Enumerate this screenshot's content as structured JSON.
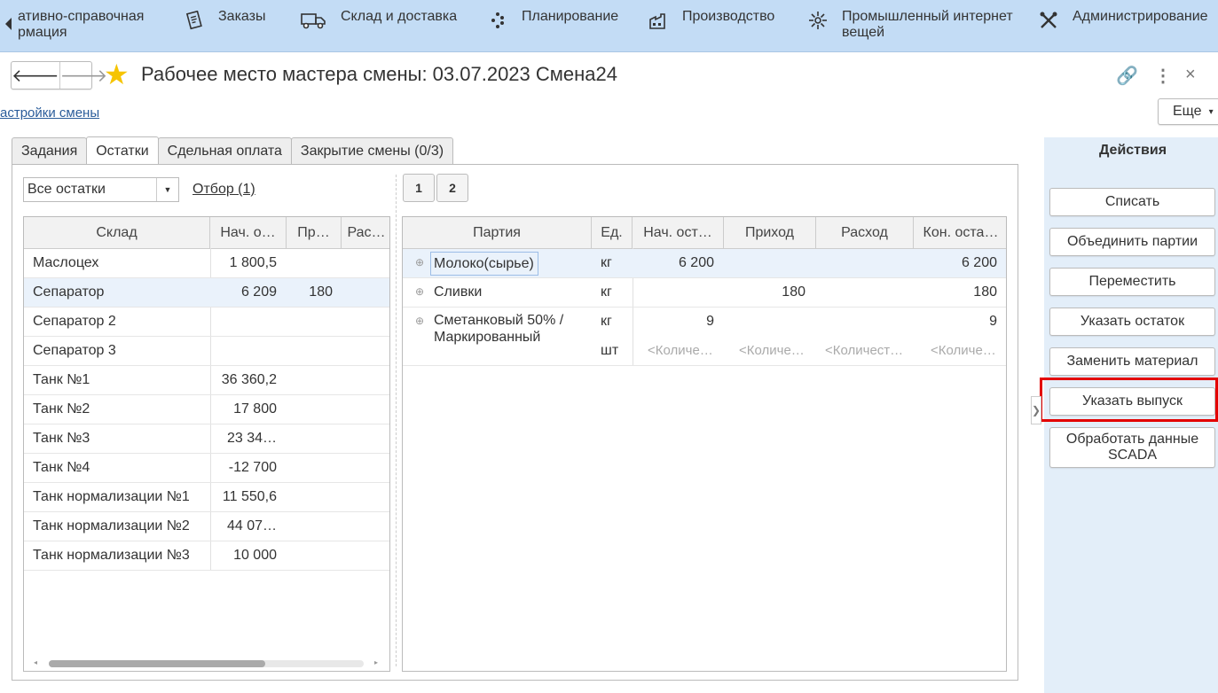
{
  "nav": {
    "items": [
      {
        "label_line1": "ативно-справочная",
        "label_line2": "рмация",
        "icon": "none"
      },
      {
        "label_line1": "Заказы",
        "label_line2": "",
        "icon": "orders-icon"
      },
      {
        "label_line1": "Склад и доставка",
        "label_line2": "",
        "icon": "truck-icon"
      },
      {
        "label_line1": "Планирование",
        "label_line2": "",
        "icon": "planning-icon"
      },
      {
        "label_line1": "Производство",
        "label_line2": "",
        "icon": "factory-icon"
      },
      {
        "label_line1": "Промышленный интернет",
        "label_line2": "вещей",
        "icon": "iot-icon"
      },
      {
        "label_line1": "Администрирование",
        "label_line2": "",
        "icon": "tools-icon"
      }
    ]
  },
  "header": {
    "back_glyph": "🡐",
    "forward_glyph": "🡒",
    "star_glyph": "★",
    "title": "Рабочее место мастера смены: 03.07.2023 Смена24",
    "link_glyph": "🔗",
    "menu_glyph": "⋮",
    "close_glyph": "×"
  },
  "shift_settings_link": "астройки смены",
  "more_button": {
    "label": "Еще",
    "arrow": "▾"
  },
  "tabs": [
    "Задания",
    "Остатки",
    "Сдельная оплата",
    "Закрытие смены (0/3)"
  ],
  "filter": {
    "select_value": "Все остатки",
    "select_arrow": "▼",
    "otbor_label": "Отбор (1)"
  },
  "pages": [
    "1",
    "2"
  ],
  "left_table": {
    "headers": [
      "Склад",
      "Нач. о…",
      "Пр…",
      "Рас…"
    ],
    "rows": [
      {
        "sklad": "Маслоцех",
        "nach": "1 800,5",
        "prih": "",
        "rash": ""
      },
      {
        "sklad": "Сепаратор",
        "nach": "6 209",
        "prih": "180",
        "rash": ""
      },
      {
        "sklad": "Сепаратор 2",
        "nach": "",
        "prih": "",
        "rash": ""
      },
      {
        "sklad": "Сепаратор 3",
        "nach": "",
        "prih": "",
        "rash": ""
      },
      {
        "sklad": "Танк №1",
        "nach": "36 360,2",
        "prih": "",
        "rash": ""
      },
      {
        "sklad": "Танк №2",
        "nach": "17 800",
        "prih": "",
        "rash": ""
      },
      {
        "sklad": "Танк №3",
        "nach": "23 34…",
        "prih": "",
        "rash": ""
      },
      {
        "sklad": "Танк №4",
        "nach": "-12 700",
        "prih": "",
        "rash": ""
      },
      {
        "sklad": "Танк нормализации №1",
        "nach": "11 550,6",
        "prih": "",
        "rash": ""
      },
      {
        "sklad": "Танк нормализации №2",
        "nach": "44 07…",
        "prih": "",
        "rash": ""
      },
      {
        "sklad": "Танк нормализации №3",
        "nach": "10 000",
        "prih": "",
        "rash": ""
      }
    ],
    "scroll_left": "◂",
    "scroll_right": "▸"
  },
  "right_table": {
    "headers": [
      "Партия",
      "Ед.",
      "Нач. ост…",
      "Приход",
      "Расход",
      "Кон. оста…"
    ],
    "expand_glyph": "⊕",
    "rows": [
      {
        "partia": "Молоко(сырье)",
        "ed": "кг",
        "nach": "6 200",
        "prih": "",
        "rash": "",
        "kon": "6 200"
      },
      {
        "partia": "Сливки",
        "ed": "кг",
        "nach": "",
        "prih": "180",
        "rash": "",
        "kon": "180"
      },
      {
        "partia_line1": "Сметанковый 50% /",
        "partia_line2": "Маркированный",
        "ed": "кг",
        "nach": "9",
        "prih": "",
        "rash": "",
        "kon": "9",
        "ed2": "шт",
        "nach2": "<Количе…",
        "prih2": "<Количе…",
        "rash2": "<Количест…",
        "kon2": "<Количе…"
      }
    ]
  },
  "actions": {
    "title": "Действия",
    "buttons": [
      {
        "label": "Списать"
      },
      {
        "label": "Объединить партии"
      },
      {
        "label": "Переместить"
      },
      {
        "label": "Указать остаток"
      },
      {
        "label": "Заменить материал"
      },
      {
        "label": "Указать выпуск"
      },
      {
        "label_line1": "Обработать данные",
        "label_line2": "SCADA"
      }
    ],
    "collapse_glyph": "❯"
  },
  "colors": {
    "nav_bg": "#c3dcf5",
    "actions_bg": "#e3eef9",
    "highlight": "#e30000",
    "selected_row": "#eaf2fb",
    "star": "#f6c400"
  }
}
